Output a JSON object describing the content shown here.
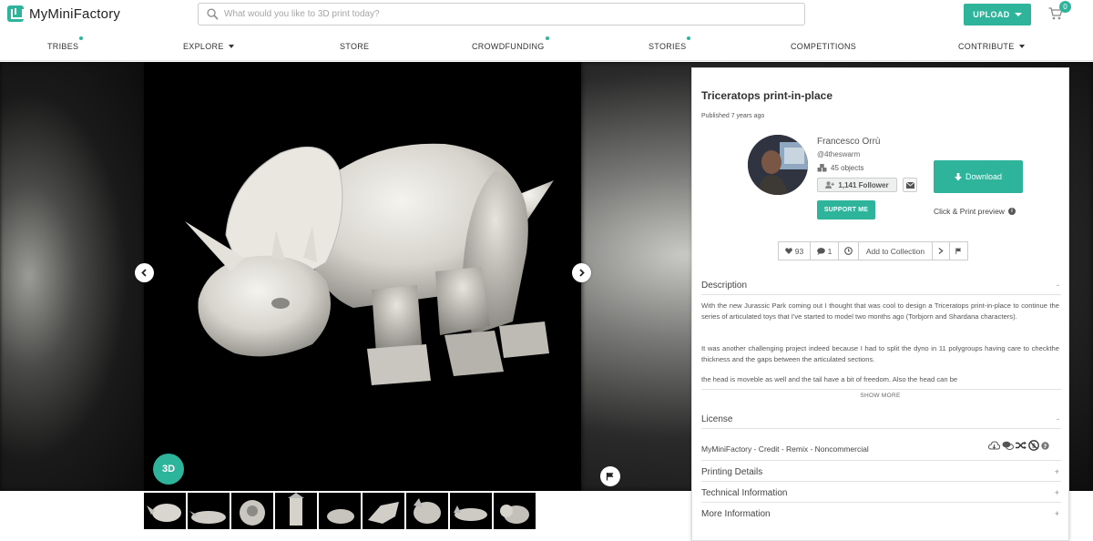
{
  "header": {
    "logo_text": "MyMiniFactory",
    "search_placeholder": "What would you like to 3D print today?",
    "upload_label": "UPLOAD",
    "cart_count": "0"
  },
  "nav": {
    "items": [
      {
        "label": "TRIBES",
        "dot": true,
        "caret": false
      },
      {
        "label": "EXPLORE",
        "dot": false,
        "caret": true
      },
      {
        "label": "STORE",
        "dot": false,
        "caret": false
      },
      {
        "label": "CROWDFUNDING",
        "dot": true,
        "caret": false
      },
      {
        "label": "STORIES",
        "dot": true,
        "caret": false
      },
      {
        "label": "COMPETITIONS",
        "dot": false,
        "caret": false
      },
      {
        "label": "CONTRIBUTE",
        "dot": false,
        "caret": true
      }
    ]
  },
  "viewer": {
    "badge_3d": "3D"
  },
  "object": {
    "title": "Triceratops print-in-place",
    "published": "Published 7 years ago",
    "designer": {
      "name": "Francesco Orrù",
      "handle": "@4theswarm",
      "objects": "45 objects",
      "followers": "1,141 Follower",
      "support_label": "SUPPORT ME"
    },
    "download_label": "Download",
    "click_print_label": "Click & Print preview",
    "actions": {
      "likes": "93",
      "comments": "1",
      "add_collection": "Add to Collection"
    },
    "description": {
      "heading": "Description",
      "toggle": "-",
      "paragraphs": [
        "With the new Jurassic Park coming out I thought that was cool to design a Triceratops print-in-place to continue the series of articulated toys that I've started to model two months ago (Torbjorn and Shardana characters).",
        "It was another challenging project indeed because I had to split the dyno in 11 polygroups having care to checkthe thickness and the gaps between the articulated sections.",
        "the head is moveble as well and the tail have a bit of freedom. Also the head can be"
      ],
      "show_more": "SHOW MORE"
    },
    "license": {
      "heading": "License",
      "toggle": "-",
      "text": "MyMiniFactory - Credit - Remix - Noncommercial"
    },
    "sections": [
      {
        "heading": "Printing Details",
        "toggle": "+"
      },
      {
        "heading": "Technical Information",
        "toggle": "+"
      },
      {
        "heading": "More Information",
        "toggle": "+"
      }
    ]
  },
  "colors": {
    "brand": "#2fb49c"
  }
}
